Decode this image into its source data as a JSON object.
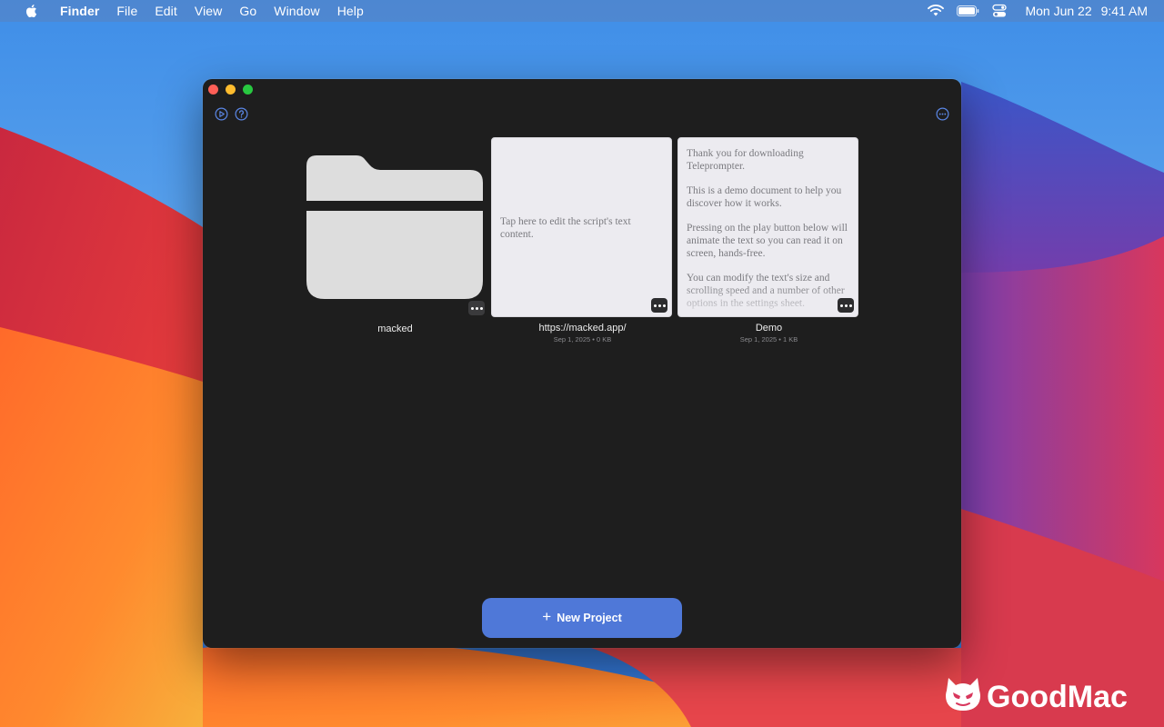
{
  "menubar": {
    "app_name": "Finder",
    "menus": [
      "File",
      "Edit",
      "View",
      "Go",
      "Window",
      "Help"
    ],
    "date": "Mon Jun 22",
    "time": "9:41 AM"
  },
  "icons": {
    "apple": "apple-icon",
    "wifi": "wifi-icon",
    "battery": "battery-icon",
    "control_center": "control-center-icon",
    "toolbar_left_1": "play-circle-icon",
    "toolbar_left_2": "help-circle-icon",
    "toolbar_right": "ellipsis-circle-icon"
  },
  "window": {
    "items": [
      {
        "type": "folder",
        "title": "macked"
      },
      {
        "type": "script",
        "title": "https://macked.app/",
        "meta": "Sep 1, 2025 • 0 KB",
        "preview": "Tap here to edit the script's text content."
      },
      {
        "type": "script",
        "title": "Demo",
        "meta": "Sep 1, 2025 • 1 KB",
        "preview_paragraphs": [
          "Thank you for downloading Teleprompter.",
          "This is a demo document to help you discover how it works.",
          "Pressing on the play button below will animate the text so you can read it on screen, hands-free.",
          "You can modify the text's size and scrolling speed and a number of other options in the settings sheet."
        ]
      }
    ],
    "new_project_label": "New Project"
  },
  "watermark": {
    "text": "GoodMac"
  },
  "colors": {
    "accent": "#4f78d8",
    "window_bg": "#1e1e1e",
    "card_bg": "#ecebf0"
  }
}
